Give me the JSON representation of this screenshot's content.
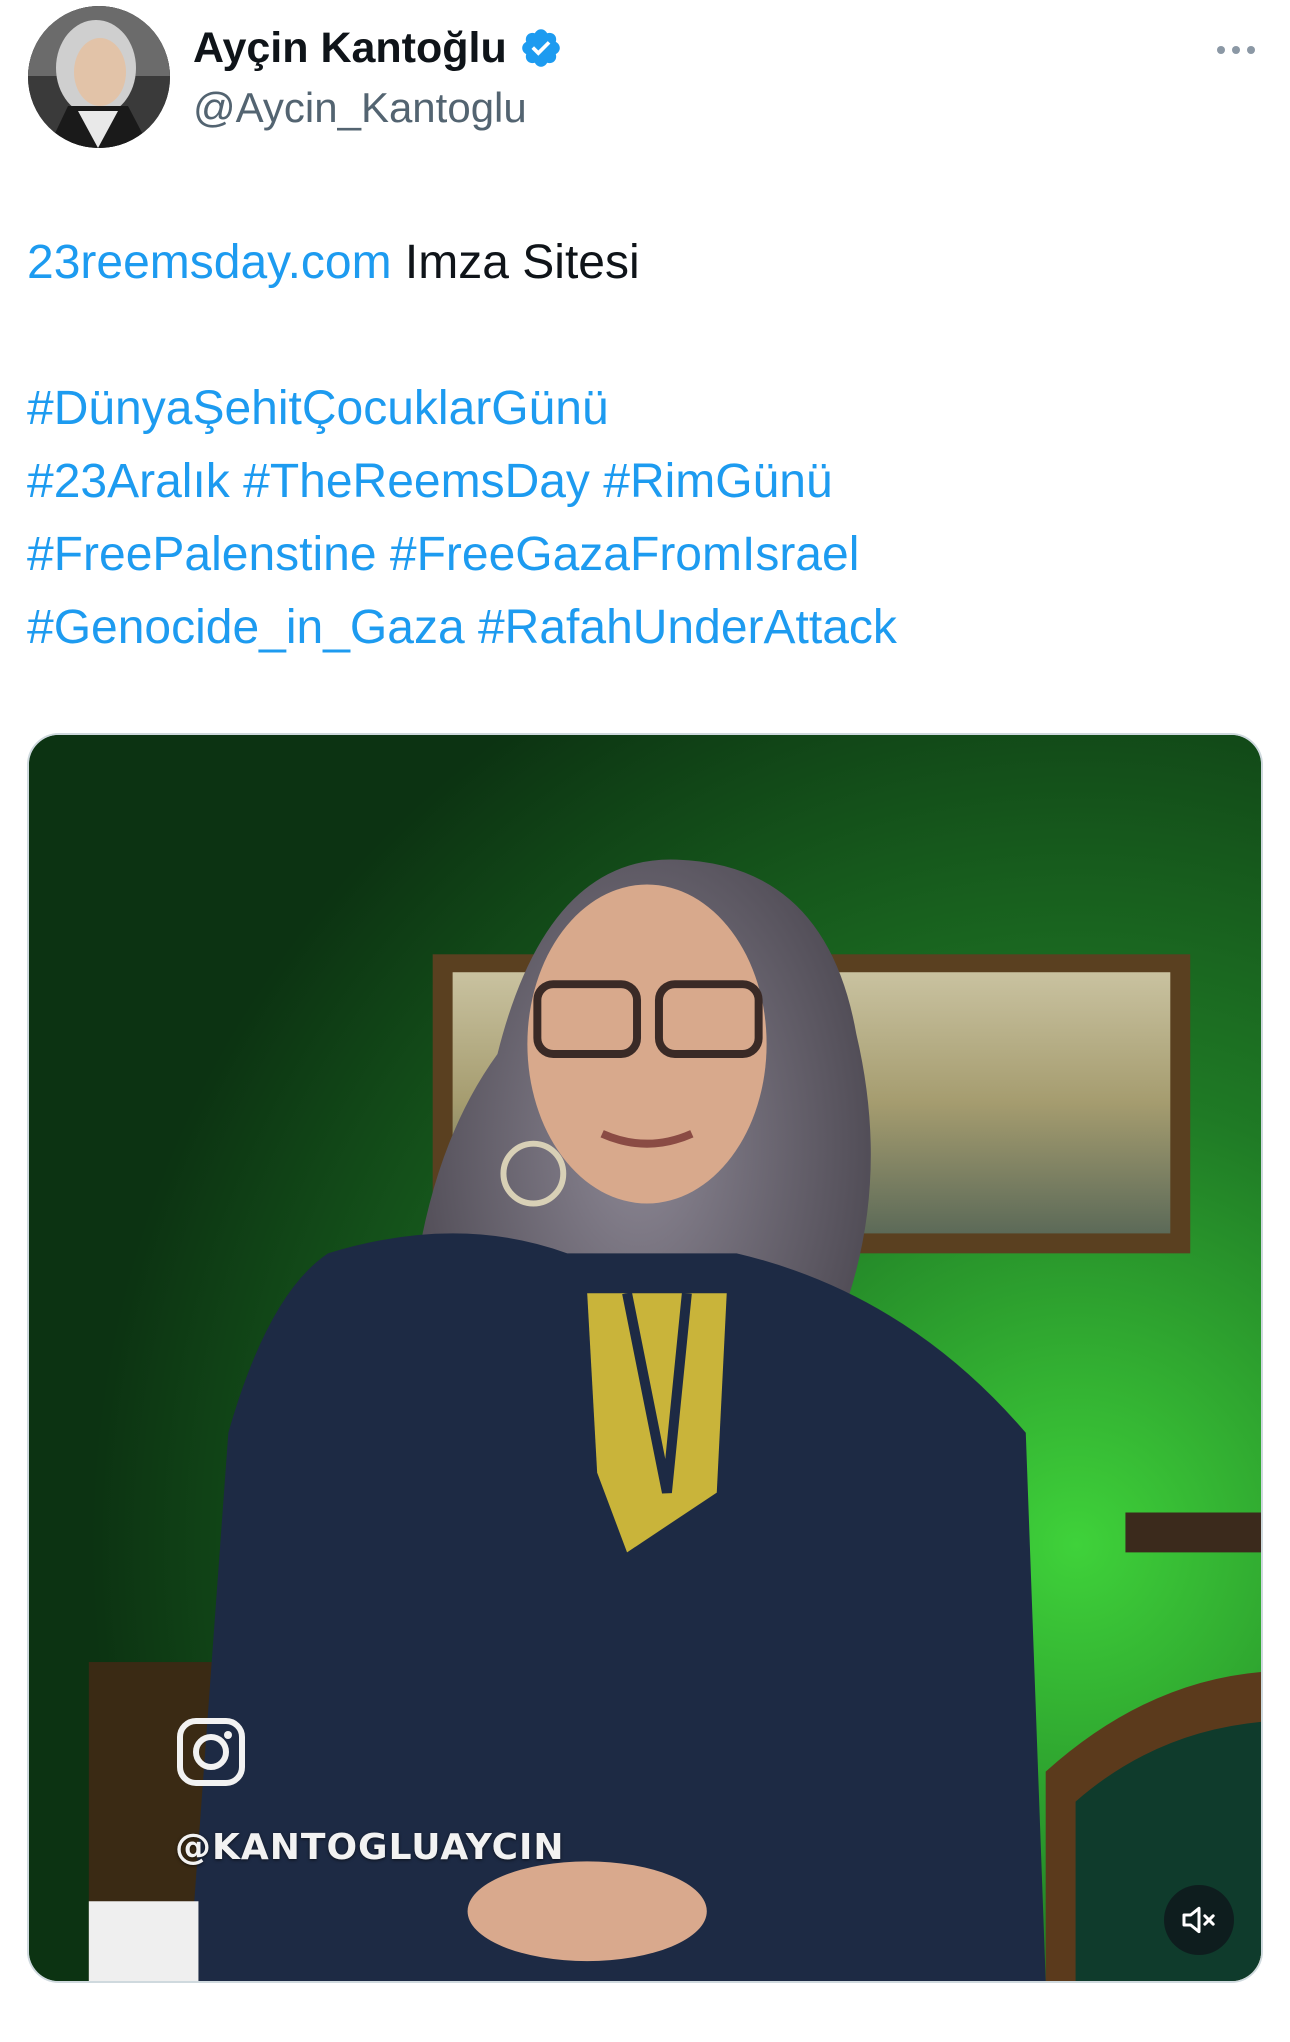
{
  "tweet": {
    "author": {
      "display_name": "Ayçin Kantoğlu",
      "handle": "@Aycin_Kantoglu",
      "verified": true
    },
    "text": {
      "link": "23reemsday.com",
      "after_link": " Imza Sitesi",
      "hashtag_lines": [
        "#DünyaŞehitÇocuklarGünü",
        "#23Aralık #TheReemsDay #RimGünü",
        "#FreePalenstine #FreeGazaFromIsrael",
        "#Genocide_in_Gaza #RafahUnderAttack"
      ]
    },
    "media": {
      "type": "video",
      "overlay_handle": "@KANTOGLUAYCIN",
      "overlay_icon": "instagram-icon",
      "muted": true
    }
  },
  "colors": {
    "link": "#1d9bf0",
    "text": "#0f1419",
    "secondary": "#536471",
    "verified": "#1d9bf0"
  }
}
